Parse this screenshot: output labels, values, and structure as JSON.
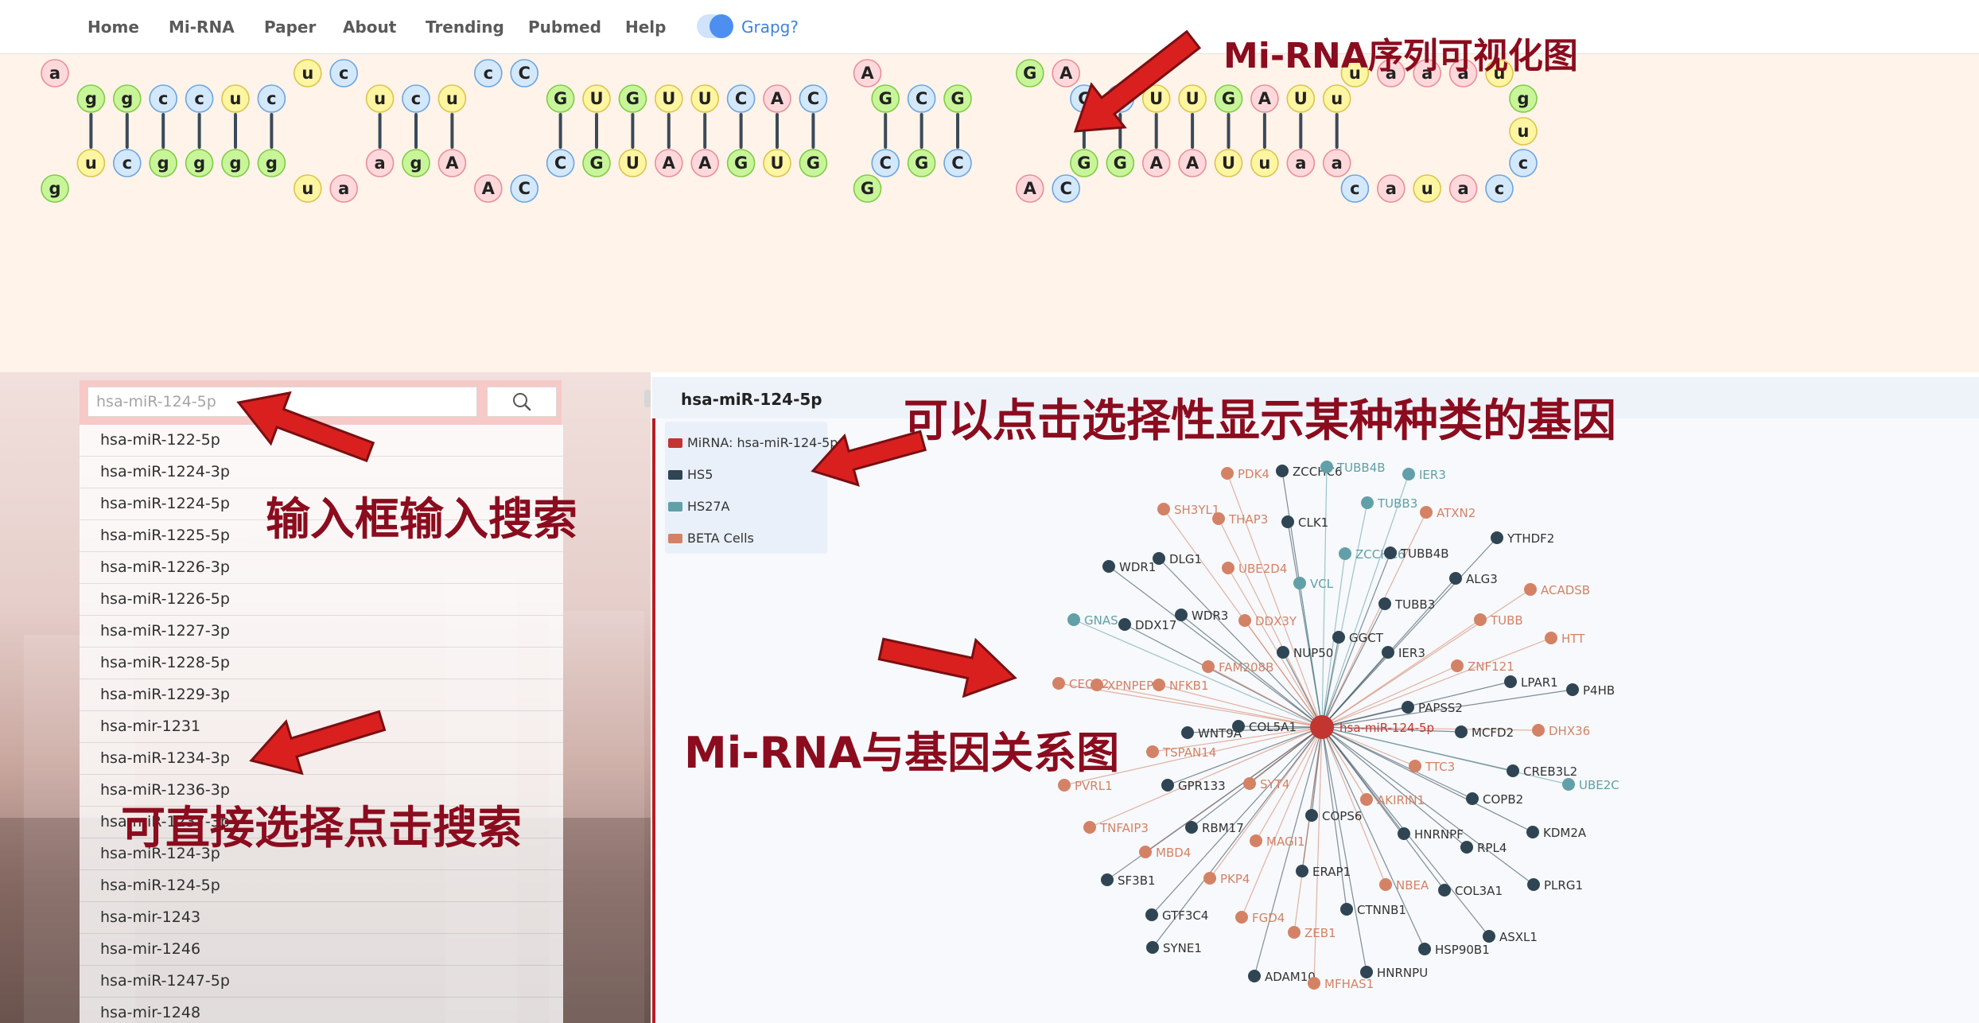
{
  "nav": {
    "items": [
      "Home",
      "Mi-RNA",
      "Paper",
      "About",
      "Trending",
      "Pubmed",
      "Help"
    ],
    "toggle_label": "Grapg?"
  },
  "rna_structure": {
    "bulge_top": [
      {
        "col": 0,
        "letter": "a"
      },
      {
        "col": 7,
        "letter": "u"
      },
      {
        "col": 8,
        "letter": "c"
      },
      {
        "col": 12,
        "letter": "c"
      },
      {
        "col": 13,
        "letter": "C"
      },
      {
        "col": 22.5,
        "letter": "A"
      },
      {
        "col": 27,
        "letter": "G"
      },
      {
        "col": 28,
        "letter": "A"
      },
      {
        "col": 36,
        "letter": "u"
      },
      {
        "col": 37,
        "letter": "a"
      },
      {
        "col": 38,
        "letter": "a"
      },
      {
        "col": 39,
        "letter": "a"
      },
      {
        "col": 40,
        "letter": "u"
      }
    ],
    "pairs_top": [
      {
        "col": 1,
        "letter": "g"
      },
      {
        "col": 2,
        "letter": "g"
      },
      {
        "col": 3,
        "letter": "c"
      },
      {
        "col": 4,
        "letter": "c"
      },
      {
        "col": 5,
        "letter": "u"
      },
      {
        "col": 6,
        "letter": "c"
      },
      {
        "col": 9,
        "letter": "u"
      },
      {
        "col": 10,
        "letter": "c"
      },
      {
        "col": 11,
        "letter": "u"
      },
      {
        "col": 14,
        "letter": "G"
      },
      {
        "col": 15,
        "letter": "U"
      },
      {
        "col": 16,
        "letter": "G"
      },
      {
        "col": 17,
        "letter": "U"
      },
      {
        "col": 18,
        "letter": "U"
      },
      {
        "col": 19,
        "letter": "C"
      },
      {
        "col": 20,
        "letter": "A"
      },
      {
        "col": 21,
        "letter": "C"
      },
      {
        "col": 23,
        "letter": "G"
      },
      {
        "col": 24,
        "letter": "C"
      },
      {
        "col": 25,
        "letter": "G"
      },
      {
        "col": 28.5,
        "letter": "C"
      },
      {
        "col": 29.5,
        "letter": "C"
      },
      {
        "col": 30.5,
        "letter": "U"
      },
      {
        "col": 31.5,
        "letter": "U"
      },
      {
        "col": 32.5,
        "letter": "G"
      },
      {
        "col": 33.5,
        "letter": "A"
      },
      {
        "col": 34.5,
        "letter": "U"
      },
      {
        "col": 35.5,
        "letter": "u"
      }
    ],
    "pairs_bottom": [
      {
        "col": 1,
        "letter": "u"
      },
      {
        "col": 2,
        "letter": "c"
      },
      {
        "col": 3,
        "letter": "g"
      },
      {
        "col": 4,
        "letter": "g"
      },
      {
        "col": 5,
        "letter": "g"
      },
      {
        "col": 6,
        "letter": "g"
      },
      {
        "col": 9,
        "letter": "a"
      },
      {
        "col": 10,
        "letter": "g"
      },
      {
        "col": 11,
        "letter": "A"
      },
      {
        "col": 14,
        "letter": "C"
      },
      {
        "col": 15,
        "letter": "G"
      },
      {
        "col": 16,
        "letter": "U"
      },
      {
        "col": 17,
        "letter": "A"
      },
      {
        "col": 18,
        "letter": "A"
      },
      {
        "col": 19,
        "letter": "G"
      },
      {
        "col": 20,
        "letter": "U"
      },
      {
        "col": 21,
        "letter": "G"
      },
      {
        "col": 23,
        "letter": "C"
      },
      {
        "col": 24,
        "letter": "G"
      },
      {
        "col": 25,
        "letter": "C"
      },
      {
        "col": 28.5,
        "letter": "G"
      },
      {
        "col": 29.5,
        "letter": "G"
      },
      {
        "col": 30.5,
        "letter": "A"
      },
      {
        "col": 31.5,
        "letter": "A"
      },
      {
        "col": 32.5,
        "letter": "U"
      },
      {
        "col": 33.5,
        "letter": "u"
      },
      {
        "col": 34.5,
        "letter": "a"
      },
      {
        "col": 35.5,
        "letter": "a"
      }
    ],
    "bulge_bottom": [
      {
        "col": 0,
        "letter": "g"
      },
      {
        "col": 7,
        "letter": "u"
      },
      {
        "col": 8,
        "letter": "a"
      },
      {
        "col": 12,
        "letter": "A"
      },
      {
        "col": 13,
        "letter": "C"
      },
      {
        "col": 22.5,
        "letter": "G"
      },
      {
        "col": 27,
        "letter": "A"
      },
      {
        "col": 28,
        "letter": "C"
      },
      {
        "col": 36,
        "letter": "c"
      },
      {
        "col": 37,
        "letter": "a"
      },
      {
        "col": 38,
        "letter": "u"
      },
      {
        "col": 39,
        "letter": "a"
      },
      {
        "col": 40,
        "letter": "c"
      }
    ],
    "loop_right": [
      {
        "row": "top",
        "letter": "g"
      },
      {
        "row": "mid",
        "letter": "u"
      },
      {
        "row": "bottom",
        "letter": "c"
      }
    ]
  },
  "nucleotide_colors": {
    "a": "#ffd8dc",
    "u": "#fff5a3",
    "g": "#c9f59a",
    "c": "#d4e8fb"
  },
  "search": {
    "placeholder": "hsa-miR-124-5p",
    "list": [
      "hsa-miR-122-5p",
      "hsa-miR-1224-3p",
      "hsa-miR-1224-5p",
      "hsa-miR-1225-5p",
      "hsa-miR-1226-3p",
      "hsa-miR-1226-5p",
      "hsa-miR-1227-3p",
      "hsa-miR-1228-5p",
      "hsa-miR-1229-3p",
      "hsa-mir-1231",
      "hsa-miR-1234-3p",
      "hsa-miR-1236-3p",
      "hsa-miR-1237-3p",
      "hsa-miR-124-3p",
      "hsa-miR-124-5p",
      "hsa-mir-1243",
      "hsa-mir-1246",
      "hsa-miR-1247-5p",
      "hsa-mir-1248"
    ]
  },
  "graph": {
    "title": "hsa-miR-124-5p",
    "center_label": "hsa-miR-124-5p",
    "legend": [
      {
        "label": "MiRNA: hsa-miR-124-5p",
        "color": "#c23531"
      },
      {
        "label": "HS5",
        "color": "#2f4554"
      },
      {
        "label": "HS27A",
        "color": "#61a0a8"
      },
      {
        "label": "BETA Cells",
        "color": "#d48265"
      }
    ],
    "category_colors": {
      "hs5": "#2f4554",
      "hs27a": "#61a0a8",
      "beta": "#d48265"
    },
    "nodes": [
      {
        "name": "PDK4",
        "cat": "beta"
      },
      {
        "name": "ZCCHC6",
        "cat": "hs5"
      },
      {
        "name": "TUBB4B",
        "cat": "hs27a"
      },
      {
        "name": "IER3",
        "cat": "hs27a"
      },
      {
        "name": "SH3YL1",
        "cat": "beta"
      },
      {
        "name": "THAP3",
        "cat": "beta"
      },
      {
        "name": "CLK1",
        "cat": "hs5"
      },
      {
        "name": "TUBB3",
        "cat": "hs27a"
      },
      {
        "name": "ATXN2",
        "cat": "beta"
      },
      {
        "name": "YTHDF2",
        "cat": "hs5"
      },
      {
        "name": "WDR1",
        "cat": "hs5"
      },
      {
        "name": "DLG1",
        "cat": "hs5"
      },
      {
        "name": "UBE2D4",
        "cat": "beta"
      },
      {
        "name": "ZCCHC6",
        "cat": "hs27a"
      },
      {
        "name": "TUBB4B",
        "cat": "hs5"
      },
      {
        "name": "VCL",
        "cat": "hs27a"
      },
      {
        "name": "ALG3",
        "cat": "hs5"
      },
      {
        "name": "ACADSB",
        "cat": "beta"
      },
      {
        "name": "GNAS",
        "cat": "hs27a"
      },
      {
        "name": "DDX17",
        "cat": "hs5"
      },
      {
        "name": "WDR3",
        "cat": "hs5"
      },
      {
        "name": "DDX3Y",
        "cat": "beta"
      },
      {
        "name": "TUBB3",
        "cat": "hs5"
      },
      {
        "name": "TUBB",
        "cat": "beta"
      },
      {
        "name": "GGCT",
        "cat": "hs5"
      },
      {
        "name": "HTT",
        "cat": "beta"
      },
      {
        "name": "NUP50",
        "cat": "hs5"
      },
      {
        "name": "IER3",
        "cat": "hs5"
      },
      {
        "name": "FAM208B",
        "cat": "beta"
      },
      {
        "name": "ZNF121",
        "cat": "beta"
      },
      {
        "name": "CECR2",
        "cat": "beta"
      },
      {
        "name": "XPNPEP1",
        "cat": "beta"
      },
      {
        "name": "NFKB1",
        "cat": "beta"
      },
      {
        "name": "LPAR1",
        "cat": "hs5"
      },
      {
        "name": "P4HB",
        "cat": "hs5"
      },
      {
        "name": "PAPSS2",
        "cat": "hs5"
      },
      {
        "name": "WNT9A",
        "cat": "hs5"
      },
      {
        "name": "COL5A1",
        "cat": "hs5"
      },
      {
        "name": "MCFD2",
        "cat": "hs5"
      },
      {
        "name": "DHX36",
        "cat": "beta"
      },
      {
        "name": "TSPAN14",
        "cat": "beta"
      },
      {
        "name": "TTC3",
        "cat": "beta"
      },
      {
        "name": "CREB3L2",
        "cat": "hs5"
      },
      {
        "name": "UBE2C",
        "cat": "hs27a"
      },
      {
        "name": "PVRL1",
        "cat": "beta"
      },
      {
        "name": "GPR133",
        "cat": "hs5"
      },
      {
        "name": "SYT4",
        "cat": "beta"
      },
      {
        "name": "AKIRIN1",
        "cat": "beta"
      },
      {
        "name": "COPB2",
        "cat": "hs5"
      },
      {
        "name": "COPS6",
        "cat": "hs5"
      },
      {
        "name": "TNFAIP3",
        "cat": "beta"
      },
      {
        "name": "RBM17",
        "cat": "hs5"
      },
      {
        "name": "HNRNPF",
        "cat": "hs5"
      },
      {
        "name": "KDM2A",
        "cat": "hs5"
      },
      {
        "name": "MAGI1",
        "cat": "beta"
      },
      {
        "name": "MBD4",
        "cat": "beta"
      },
      {
        "name": "RPL4",
        "cat": "hs5"
      },
      {
        "name": "ERAP1",
        "cat": "hs5"
      },
      {
        "name": "SF3B1",
        "cat": "hs5"
      },
      {
        "name": "PKP4",
        "cat": "beta"
      },
      {
        "name": "NBEA",
        "cat": "beta"
      },
      {
        "name": "COL3A1",
        "cat": "hs5"
      },
      {
        "name": "PLRG1",
        "cat": "hs5"
      },
      {
        "name": "GTF3C4",
        "cat": "hs5"
      },
      {
        "name": "FGD4",
        "cat": "beta"
      },
      {
        "name": "CTNNB1",
        "cat": "hs5"
      },
      {
        "name": "ZEB1",
        "cat": "beta"
      },
      {
        "name": "ASXL1",
        "cat": "hs5"
      },
      {
        "name": "SYNE1",
        "cat": "hs5"
      },
      {
        "name": "HSP90B1",
        "cat": "hs5"
      },
      {
        "name": "HNRNPU",
        "cat": "hs5"
      },
      {
        "name": "ADAM10",
        "cat": "hs5"
      },
      {
        "name": "MFHAS1",
        "cat": "beta"
      }
    ]
  },
  "annotations": {
    "rna_title": "Mi-RNA序列可视化图",
    "legend_hint": "可以点击选择性显示某种种类的基因",
    "search_hint": "输入框输入搜索",
    "relation": "Mi-RNA与基因关系图",
    "list_hint": "可直接选择点击搜索"
  },
  "colors": {
    "annotation": "#8b0c1e",
    "arrow_fill": "#d9201f",
    "arrow_stroke": "#7a0f12"
  }
}
